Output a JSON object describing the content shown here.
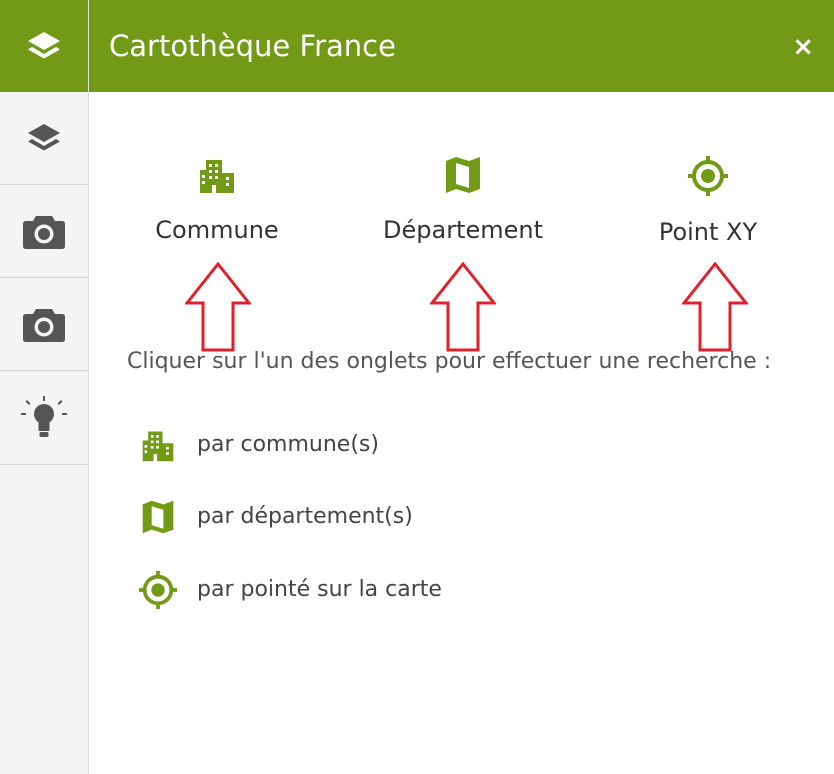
{
  "header": {
    "title": "Cartothèque France",
    "close_label": "×"
  },
  "sidebar": {
    "items": [
      {
        "name": "layers",
        "icon": "layers-icon",
        "active": true
      },
      {
        "name": "layers-2",
        "icon": "layers-icon"
      },
      {
        "name": "camera-1",
        "icon": "camera-icon"
      },
      {
        "name": "camera-2",
        "icon": "camera-icon"
      },
      {
        "name": "lightbulb",
        "icon": "lightbulb-icon"
      }
    ]
  },
  "tabs": [
    {
      "label": "Commune",
      "icon": "city-icon"
    },
    {
      "label": "Département",
      "icon": "map-icon"
    },
    {
      "label": "Point XY",
      "icon": "crosshair-icon"
    }
  ],
  "instruction": "Cliquer sur l'un des onglets pour effectuer une recherche :",
  "options": [
    {
      "label": "par commune(s)",
      "icon": "city-icon"
    },
    {
      "label": "par département(s)",
      "icon": "map-icon"
    },
    {
      "label": "par pointé sur la carte",
      "icon": "crosshair-icon"
    }
  ],
  "colors": {
    "accent": "#739a17",
    "arrow": "#e0202a",
    "sidebar_icon": "#555555"
  }
}
